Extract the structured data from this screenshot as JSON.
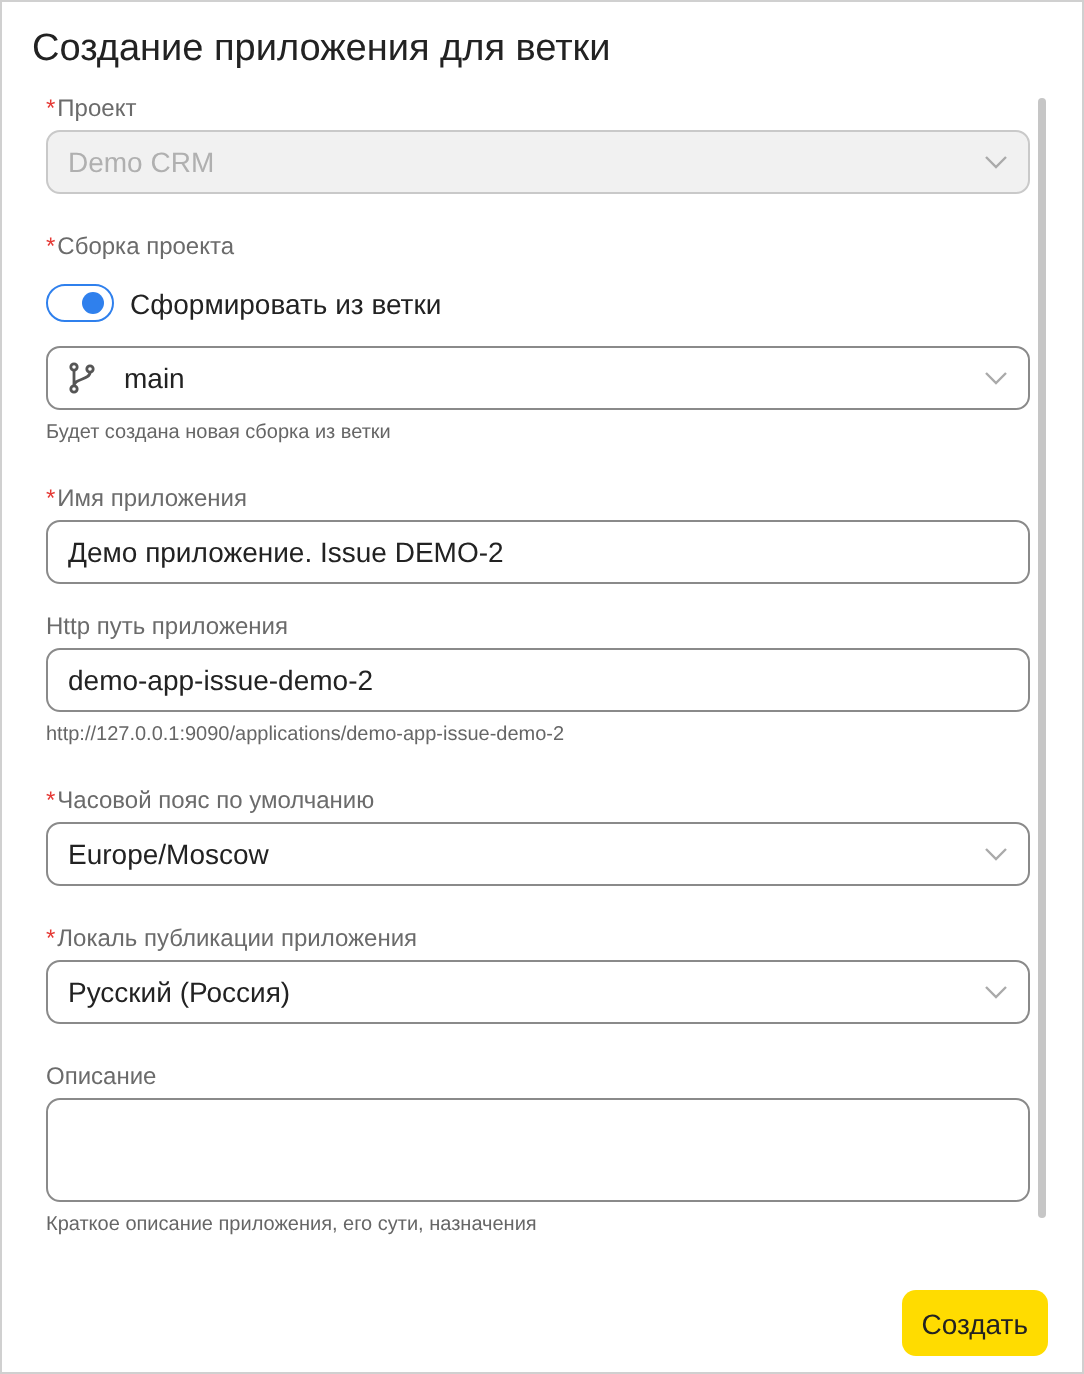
{
  "dialog": {
    "title": "Создание приложения для ветки"
  },
  "fields": [
    {
      "kind": "select",
      "label": "Проект",
      "required_mark": "*",
      "value": "Demo CRM",
      "disabled": true
    },
    {
      "kind": "toggle",
      "label": "Сборка проекта",
      "required_mark": "*",
      "toggle_label": "Сформировать из ветки",
      "on": true
    },
    {
      "kind": "branch-select",
      "value": "main",
      "disabled": false,
      "hint": "Будет создана новая сборка из ветки"
    },
    {
      "kind": "input",
      "label": "Имя приложения",
      "required_mark": "*",
      "value": "Демо приложение. Issue DEMO-2"
    },
    {
      "kind": "input",
      "label": "Http путь приложения",
      "value": "demo-app-issue-demo-2",
      "hint": "http://127.0.0.1:9090/applications/demo-app-issue-demo-2"
    },
    {
      "kind": "select",
      "label": "Часовой пояс по умолчанию",
      "required_mark": "*",
      "value": "Europe/Moscow",
      "disabled": false
    },
    {
      "kind": "select",
      "label": "Локаль публикации приложения",
      "required_mark": "*",
      "value": "Русский (Россия)",
      "disabled": false
    },
    {
      "kind": "textarea",
      "label": "Описание",
      "hint": "Краткое описание приложения, его сути, назначения"
    }
  ],
  "buttons": [
    {
      "label": "Создать"
    }
  ]
}
